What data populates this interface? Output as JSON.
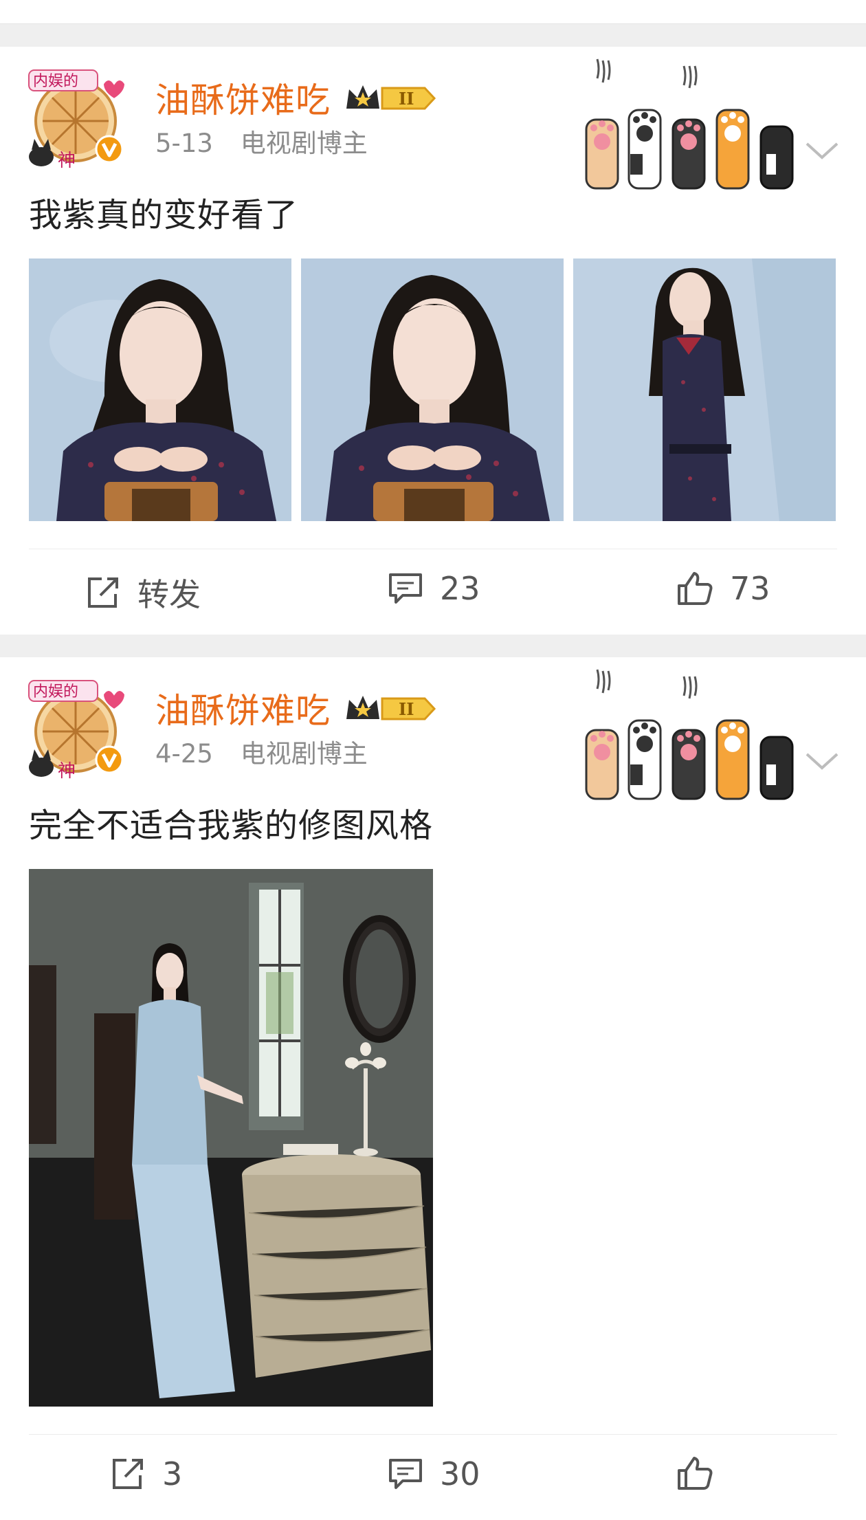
{
  "posts": [
    {
      "author": "油酥饼难吃",
      "avatar_badge": "内娱的神",
      "date": "5-13",
      "role": "电视剧博主",
      "text": "我紫真的变好看了",
      "repost_label": "转发",
      "comment_count": "23",
      "like_count": "73"
    },
    {
      "author": "油酥饼难吃",
      "avatar_badge": "内娱的神",
      "date": "4-25",
      "role": "电视剧博主",
      "text": "完全不适合我紫的修图风格",
      "repost_count": "3",
      "comment_count": "30"
    }
  ],
  "icons": {
    "verified": "verified-badge-icon",
    "crown": "crown-level-badge-icon",
    "decor": "cat-paws-decoration",
    "more": "chevron-down-icon",
    "repost": "repost-icon",
    "comment": "comment-icon",
    "like": "like-icon"
  },
  "colors": {
    "username": "#e86b1a",
    "meta": "#8c8c8c",
    "divider": "#efefef",
    "verified": "#f39a10"
  }
}
